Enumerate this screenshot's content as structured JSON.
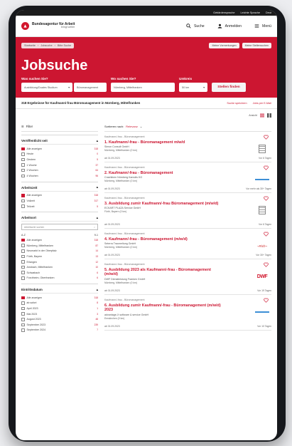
{
  "topbar": {
    "links": [
      "Gebärdensprache",
      "Leichte Sprache",
      "Deut"
    ]
  },
  "header": {
    "logo_name": "Bundesagentur für Arbeit",
    "logo_tagline": "bringt weiter",
    "search_label": "Suche",
    "login_label": "Anmelden",
    "menu_label": "Menü"
  },
  "breadcrumb": {
    "items": [
      "Startseite",
      "Jobsuche",
      "Bitte Suche"
    ]
  },
  "crumb_actions": {
    "notes": "Meine Vormerkungen",
    "saved": "Meine Stellensuchen"
  },
  "hero": {
    "title": "Jobsuche",
    "what_label": "Was suchen Sie?",
    "what_type": "Ausbildung/Duales Studium",
    "what_value": "Büromanagement",
    "where_label": "Wo suchen Sie?",
    "where_value": "Nürnberg, Mittelfranken",
    "radius_label": "Umkreis",
    "radius_value": "50 km",
    "find_button": "Stellen finden"
  },
  "results": {
    "count_text": "318 Ergebnisse für Kaufmann/-frau Büromanagement in Nürnberg, Mittelfranken",
    "save_search": "Suche speichern",
    "email_jobs": "Jobs per E-Mail",
    "view_label": "Ansicht"
  },
  "sidebar": {
    "filter_label": "Filter",
    "published": {
      "title": "Veröffentlicht seit",
      "options": [
        {
          "label": "Alle anzeigen",
          "count": "318",
          "checked": true
        },
        {
          "label": "Heute",
          "count": "0",
          "checked": false
        },
        {
          "label": "Gestern",
          "count": "5",
          "checked": false
        },
        {
          "label": "1 Woche",
          "count": "37",
          "checked": false
        },
        {
          "label": "2 Wochen",
          "count": "64",
          "checked": false
        },
        {
          "label": "4 Wochen",
          "count": "96",
          "checked": false
        }
      ]
    },
    "worktime": {
      "title": "Arbeitszeit",
      "options": [
        {
          "label": "Alle anzeigen",
          "count": "318",
          "checked": true
        },
        {
          "label": "Vollzeit",
          "count": "317",
          "checked": false
        },
        {
          "label": "Teilzeit",
          "count": "5",
          "checked": false
        }
      ]
    },
    "location": {
      "title": "Arbeitsort",
      "search_placeholder": "Arbeitsorte suchen",
      "sort_az": "A-Z",
      "sort_num": "9-1",
      "options": [
        {
          "label": "Alle anzeigen",
          "count": "318",
          "checked": true
        },
        {
          "label": "Nürnberg, Mittelfranken",
          "count": "87",
          "checked": false
        },
        {
          "label": "Neumarkt in der Oberpfalz",
          "count": "14",
          "checked": false
        },
        {
          "label": "Fürth, Bayern",
          "count": "13",
          "checked": false
        },
        {
          "label": "Erlangen",
          "count": "12",
          "checked": false
        },
        {
          "label": "Ansbach, Mittelfranken",
          "count": "10",
          "checked": false
        },
        {
          "label": "Schwabach",
          "count": "6",
          "checked": false
        },
        {
          "label": "Forchheim, Oberfranken",
          "count": "6",
          "checked": false
        }
      ]
    },
    "entry": {
      "title": "Eintrittsdatum",
      "options": [
        {
          "label": "Alle anzeigen",
          "count": "318",
          "checked": true
        },
        {
          "label": "ab sofort",
          "count": "8",
          "checked": false
        },
        {
          "label": "April 2023",
          "count": "1",
          "checked": false
        },
        {
          "label": "Mai 2023",
          "count": "3",
          "checked": false
        },
        {
          "label": "August 2023",
          "count": "48",
          "checked": false
        },
        {
          "label": "September 2023",
          "count": "239",
          "checked": false
        },
        {
          "label": "September 2024",
          "count": "7",
          "checked": false
        }
      ]
    }
  },
  "list": {
    "sort_prefix": "Sortieren nach:",
    "sort_value": "Relevanz",
    "cards": [
      {
        "category": "Kaufmann/-frau - Büromanagement",
        "title": "1. Kaufmann/-frau - Büromanagement m/w/d",
        "company": "Simon Consult GmbH",
        "location": "Nürnberg, Mittelfranken (0 km)",
        "date": "ab 01.09.2023",
        "ago": "Vor 6 Tagen",
        "logo": "building"
      },
      {
        "category": "Kaufmann/-frau - Büromanagement",
        "title": "2. Kaufmann/-frau - Büromanagement",
        "company": "Crashlinen Nürnberg Kamolis KG",
        "location": "Nürnberg, Mittelfranken (0 km)",
        "date": "ab 01.09.2023",
        "ago": "Vor mehr als 30+ Tagen",
        "logo": "bar"
      },
      {
        "category": "Kaufmann/-frau - Büromanagement",
        "title": "3. Ausbildung zum/r Kaufmann/-frau Büromanagement (m/w/d)",
        "company": "ECKART PLAZA Service GmbH",
        "location": "Fürth, Bayern (0 km)",
        "date": "ab 01.09.2023",
        "ago": "Vor 6 Tagen",
        "logo": "building"
      },
      {
        "category": "Kaufmann/-frau - Büromanagement",
        "title": "4. Kaufmann/-frau - Büromanagement (m/w/d)",
        "company": "Seterra Traumeltung GmbH",
        "location": "Nürnberg, Mittelfranken (0 km)",
        "date": "ab 01.09.2023",
        "ago": "Vor 30+ Tagen",
        "logo": "script"
      },
      {
        "category": "Kaufmann/-frau - Büromanagement",
        "title": "5. Ausbildung 2023 als Kaufmann/-frau - Büromanagement (m/w/d)",
        "company": "DWF Dienstleistung Franken GmbH",
        "location": "Nürnberg, Mittelfranken (0 km)",
        "date": "ab 01.09.2023",
        "ago": "Vor 19 Tagen",
        "logo": "dwf"
      },
      {
        "category": "Kaufmann/-frau - Büromanagement",
        "title": "6. Ausbildung zum/r Kaufmann/-frau - Büromanagement (m/w/d) 2023",
        "company": "advantage-X software & service GmbH",
        "location": "Emskirchen (0 km)",
        "date": "ab 01.09.2023",
        "ago": "Vor 10 Tagen",
        "logo": "bar"
      }
    ]
  },
  "colors": {
    "brand": "#cc1631",
    "dark": "#1c1c1c"
  },
  "icons": [
    "search-icon",
    "user-icon",
    "menu-icon",
    "heart-icon",
    "filter-icon",
    "list-view-icon",
    "grid-view-icon"
  ]
}
